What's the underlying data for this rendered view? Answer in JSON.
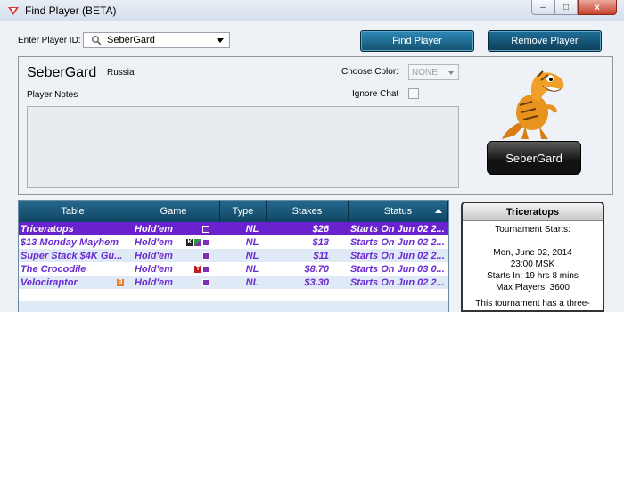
{
  "window": {
    "title": "Find Player (BETA)",
    "controls": {
      "minimize": "–",
      "maximize": "□",
      "close": "x"
    }
  },
  "search": {
    "label": "Enter Player ID:",
    "value": "SeberGard",
    "find_button": "Find Player",
    "remove_button": "Remove Player"
  },
  "player": {
    "name": "SeberGard",
    "country": "Russia",
    "notes_label": "Player Notes",
    "notes": "",
    "choose_color_label": "Choose Color:",
    "color_value": "NONE",
    "ignore_chat_label": "Ignore Chat",
    "ignore_chat_checked": false,
    "badge_name": "SeberGard",
    "avatar": "orange-dinosaur-avatar"
  },
  "table": {
    "headers": [
      "Table",
      "Game",
      "Type",
      "Stakes",
      "Status"
    ],
    "sorted_column": "Status",
    "rows": [
      {
        "table": "Triceratops",
        "table_icon": "",
        "game": "Hold'em",
        "game_icons": [
          "flag"
        ],
        "type": "NL",
        "stakes": "$26",
        "status": "Starts On Jun 02 2...",
        "selected": true
      },
      {
        "table": "$13 Monday Mayhem",
        "table_icon": "",
        "game": "Hold'em",
        "game_icons": [
          "K",
          "green",
          "flag"
        ],
        "type": "NL",
        "stakes": "$13",
        "status": "Starts On Jun 02 2...",
        "selected": false
      },
      {
        "table": "Super Stack $4K Gu...",
        "table_icon": "",
        "game": "Hold'em",
        "game_icons": [
          "flag"
        ],
        "type": "NL",
        "stakes": "$11",
        "status": "Starts On Jun 02 2...",
        "selected": false
      },
      {
        "table": "The Crocodile",
        "table_icon": "",
        "game": "Hold'em",
        "game_icons": [
          "T",
          "flag"
        ],
        "type": "NL",
        "stakes": "$8.70",
        "status": "Starts On Jun 03 0...",
        "selected": false
      },
      {
        "table": "Velociraptor",
        "table_icon": "B",
        "game": "Hold'em",
        "game_icons": [
          "flag"
        ],
        "type": "NL",
        "stakes": "$3.30",
        "status": "Starts On Jun 02 2...",
        "selected": false
      }
    ]
  },
  "info": {
    "title": "Triceratops",
    "starts_label": "Tournament Starts:",
    "date": "Mon, June 02, 2014",
    "time": "23:00 MSK",
    "starts_in": "Starts In: 19 hrs 8 mins",
    "max_players": "Max Players: 3600",
    "description": "This tournament has a three-horned face (just as with it) and"
  },
  "colors": {
    "button_top": "#2d89b6",
    "button_bottom": "#14516f",
    "grid_header": "#104563",
    "row_text": "#6a2bd1",
    "row_selected": "#6a22cf"
  }
}
